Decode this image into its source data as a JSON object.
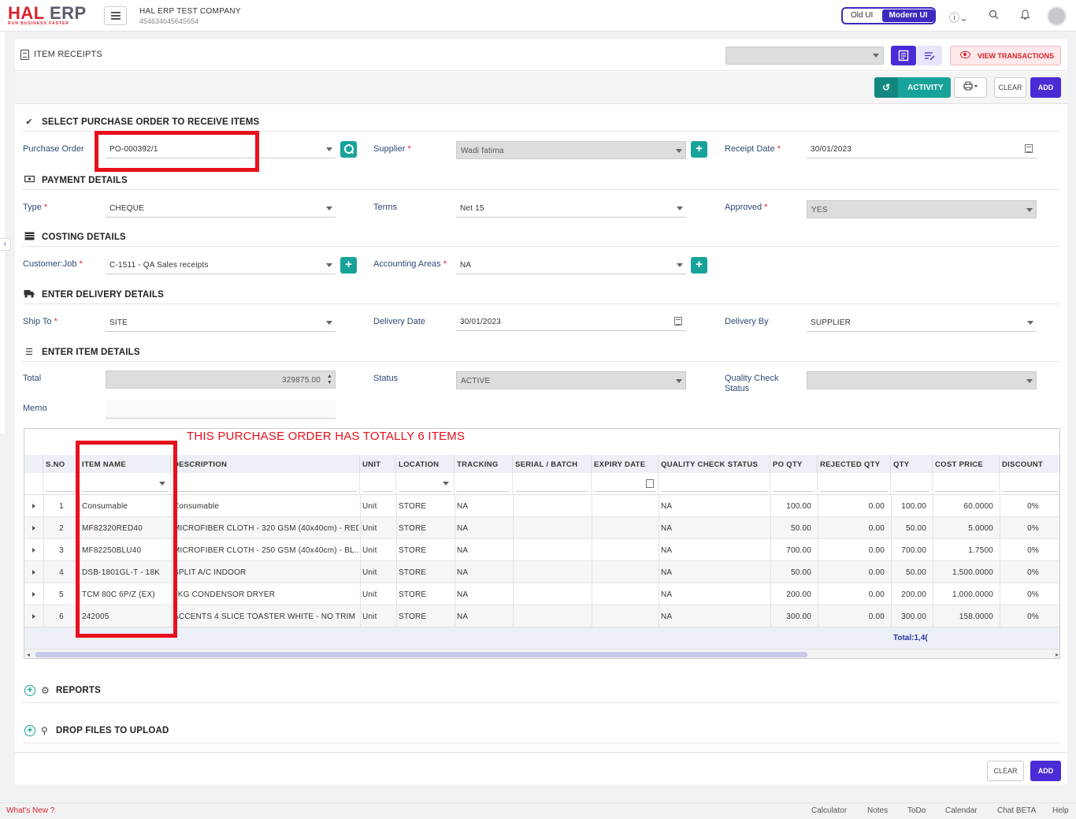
{
  "topbar": {
    "logo_main": "HAL",
    "logo_sub": "ERP",
    "logo_tagline": "RUN BUSINESS FASTER",
    "company_name": "HAL ERP TEST COMPANY",
    "company_id": "454634645645654",
    "toggle_old": "Old UI",
    "toggle_modern": "Modern UI"
  },
  "page": {
    "title": "ITEM RECEIPTS",
    "view_transactions": "VIEW TRANSACTIONS",
    "activity": "ACTIVITY",
    "clear": "CLEAR",
    "add": "ADD"
  },
  "sections": {
    "select_po": "SELECT PURCHASE ORDER TO RECEIVE ITEMS",
    "payment": "PAYMENT DETAILS",
    "costing": "COSTING DETAILS",
    "delivery": "ENTER DELIVERY DETAILS",
    "items": "ENTER ITEM DETAILS",
    "reports": "REPORTS",
    "files": "DROP FILES TO UPLOAD"
  },
  "form": {
    "purchase_order": {
      "label": "Purchase Order",
      "value": "PO-000392/1"
    },
    "supplier": {
      "label": "Supplier",
      "value": "Wadi fatima"
    },
    "receipt_date": {
      "label": "Receipt Date",
      "value": "30/01/2023"
    },
    "type": {
      "label": "Type",
      "value": "CHEQUE"
    },
    "terms": {
      "label": "Terms",
      "value": "Net 15"
    },
    "approved": {
      "label": "Approved",
      "value": "YES"
    },
    "customer_job": {
      "label": "Customer:Job",
      "value": "C-1511 - QA Sales receipts"
    },
    "accounting_areas": {
      "label": "Accounting Areas",
      "value": "NA"
    },
    "ship_to": {
      "label": "Ship To",
      "value": "SITE"
    },
    "delivery_date": {
      "label": "Delivery Date",
      "value": "30/01/2023"
    },
    "delivery_by": {
      "label": "Delivery By",
      "value": "SUPPLIER"
    },
    "total": {
      "label": "Total",
      "value": "329875.00"
    },
    "status": {
      "label": "Status",
      "value": "ACTIVE"
    },
    "qc_status": {
      "label1": "Quality Check",
      "label2": "Status",
      "value": ""
    },
    "memo": {
      "label": "Memo",
      "value": ""
    }
  },
  "annotation": "THIS PURCHASE ORDER HAS TOTALLY 6 ITEMS",
  "grid": {
    "columns": [
      "S.NO",
      "ITEM NAME",
      "DESCRIPTION",
      "UNIT",
      "LOCATION",
      "TRACKING",
      "SERIAL / BATCH",
      "EXPIRY DATE",
      "QUALITY CHECK STATUS",
      "PO QTY",
      "REJECTED QTY",
      "QTY",
      "COST PRICE",
      "DISCOUNT"
    ],
    "rows": [
      {
        "sno": "1",
        "item": "Consumable",
        "desc": "Consumable",
        "unit": "Unit",
        "loc": "STORE",
        "tracking": "NA",
        "qc": "NA",
        "po_qty": "100.00",
        "rej_qty": "0.00",
        "qty": "100.00",
        "cost": "60.0000",
        "disc": "0%"
      },
      {
        "sno": "2",
        "item": "MF82320RED40",
        "desc": "MICROFIBER CLOTH - 320 GSM (40x40cm) - RED",
        "unit": "Unit",
        "loc": "STORE",
        "tracking": "NA",
        "qc": "NA",
        "po_qty": "50.00",
        "rej_qty": "0.00",
        "qty": "50.00",
        "cost": "5.0000",
        "disc": "0%"
      },
      {
        "sno": "3",
        "item": "MF82250BLU40",
        "desc": "MICROFIBER CLOTH - 250 GSM (40x40cm) - BL...",
        "unit": "Unit",
        "loc": "STORE",
        "tracking": "NA",
        "qc": "NA",
        "po_qty": "700.00",
        "rej_qty": "0.00",
        "qty": "700.00",
        "cost": "1.7500",
        "disc": "0%"
      },
      {
        "sno": "4",
        "item": "DSB-1801GL-T - 18K",
        "desc": "SPLIT A/C INDOOR",
        "unit": "Unit",
        "loc": "STORE",
        "tracking": "NA",
        "qc": "NA",
        "po_qty": "50.00",
        "rej_qty": "0.00",
        "qty": "50.00",
        "cost": "1,500.0000",
        "disc": "0%"
      },
      {
        "sno": "5",
        "item": "TCM 80C 6P/Z (EX)",
        "desc": "8KG CONDENSOR DRYER",
        "unit": "Unit",
        "loc": "STORE",
        "tracking": "NA",
        "qc": "NA",
        "po_qty": "200.00",
        "rej_qty": "0.00",
        "qty": "200.00",
        "cost": "1,000.0000",
        "disc": "0%"
      },
      {
        "sno": "6",
        "item": "242005",
        "desc": "ACCENTS 4 SLICE TOASTER WHITE - NO TRIM",
        "unit": "Unit",
        "loc": "STORE",
        "tracking": "NA",
        "qc": "NA",
        "po_qty": "300.00",
        "rej_qty": "0.00",
        "qty": "300.00",
        "cost": "158.0000",
        "disc": "0%"
      }
    ],
    "total_label": "Total:1,4("
  },
  "bottombar": {
    "whats_new": "What's New ?",
    "links": [
      "Calculator",
      "Notes",
      "ToDo",
      "Calendar",
      "Chat BETA",
      "Help"
    ]
  }
}
